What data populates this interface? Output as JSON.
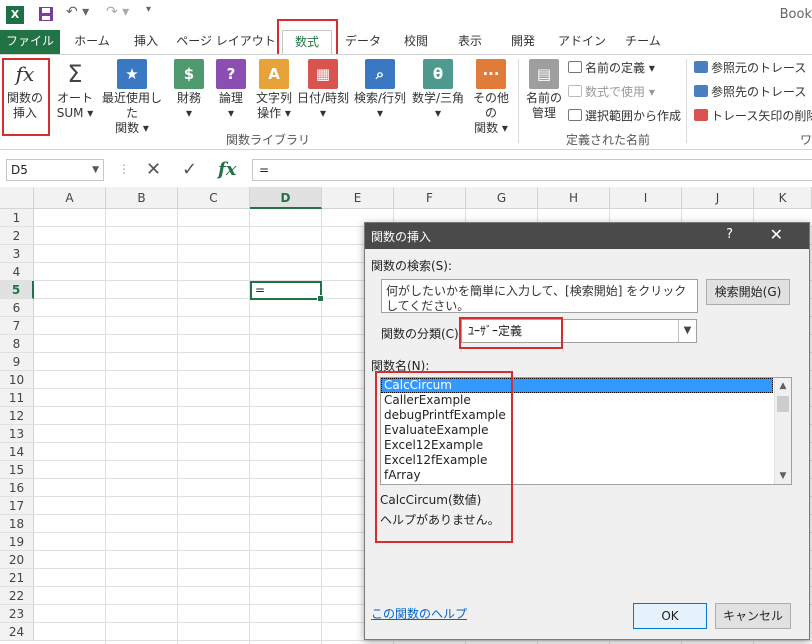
{
  "titlebar": {
    "app_title": "Book",
    "undo_icon": "undo-icon",
    "redo_icon": "redo-icon"
  },
  "tabs": [
    {
      "label": "ファイル"
    },
    {
      "label": "ホーム"
    },
    {
      "label": "挿入"
    },
    {
      "label": "ページ レイアウト"
    },
    {
      "label": "数式"
    },
    {
      "label": "データ"
    },
    {
      "label": "校閲"
    },
    {
      "label": "表示"
    },
    {
      "label": "開発"
    },
    {
      "label": "アドイン"
    },
    {
      "label": "チーム"
    }
  ],
  "ribbon": {
    "insert_function": {
      "line1": "関数の",
      "line2": "挿入",
      "icon": "fx"
    },
    "autosum": {
      "line1": "オート",
      "line2": "SUM ▾",
      "icon": "Σ"
    },
    "recent": {
      "line1": "最近使用した",
      "line2": "関数 ▾"
    },
    "financial": {
      "line1": "財務",
      "line2": "▾"
    },
    "logical": {
      "line1": "論理",
      "line2": "▾",
      "icon": "?"
    },
    "text": {
      "line1": "文字列",
      "line2": "操作 ▾",
      "icon": "A"
    },
    "datetime": {
      "line1": "日付/時刻",
      "line2": "▾"
    },
    "lookup": {
      "line1": "検索/行列",
      "line2": "▾"
    },
    "math": {
      "line1": "数学/三角",
      "line2": "▾",
      "icon": "θ"
    },
    "more": {
      "line1": "その他の",
      "line2": "関数 ▾",
      "icon": "···"
    },
    "group_function_library": "関数ライブラリ",
    "name_manager": {
      "line1": "名前の",
      "line2": "管理"
    },
    "define_name": "名前の定義 ▾",
    "use_in_formula": "数式で使用 ▾",
    "create_from_selection": "選択範囲から作成",
    "group_defined_names": "定義された名前",
    "trace_precedents": "参照元のトレース",
    "trace_dependents": "参照先のトレース",
    "remove_arrows": "トレース矢印の削除",
    "group_audit_partial": "ワ"
  },
  "formula_bar": {
    "name_box": "D5",
    "cancel": "✕",
    "enter": "✓",
    "fx": "fx",
    "content": "="
  },
  "grid": {
    "columns": [
      "A",
      "B",
      "C",
      "D",
      "E",
      "F",
      "G",
      "H",
      "I",
      "J",
      "K"
    ],
    "rows": [
      "1",
      "2",
      "3",
      "4",
      "5",
      "6",
      "7",
      "8",
      "9",
      "10",
      "11",
      "12",
      "13",
      "14",
      "15",
      "16",
      "17",
      "18",
      "19",
      "20",
      "21",
      "22",
      "23",
      "24"
    ],
    "active_cell_value": "="
  },
  "dialog": {
    "title": "関数の挿入",
    "help": "?",
    "close": "✕",
    "search_label": "関数の検索(S):",
    "search_text": "何がしたいかを簡単に入力して、[検索開始] をクリックしてください。",
    "search_button": "検索開始(G)",
    "category_label": "関数の分類(C)",
    "category_value": "ﾕｰｻﾞｰ定義",
    "list_label": "関数名(N):",
    "functions": [
      "CalcCircum",
      "CallerExample",
      "debugPrintfExample",
      "EvaluateExample",
      "Excel12Example",
      "Excel12fExample",
      "fArray"
    ],
    "signature": "CalcCircum(数値)",
    "description": "ヘルプがありません。",
    "help_link": "この関数のヘルプ",
    "ok": "OK",
    "cancel": "キャンセル"
  }
}
